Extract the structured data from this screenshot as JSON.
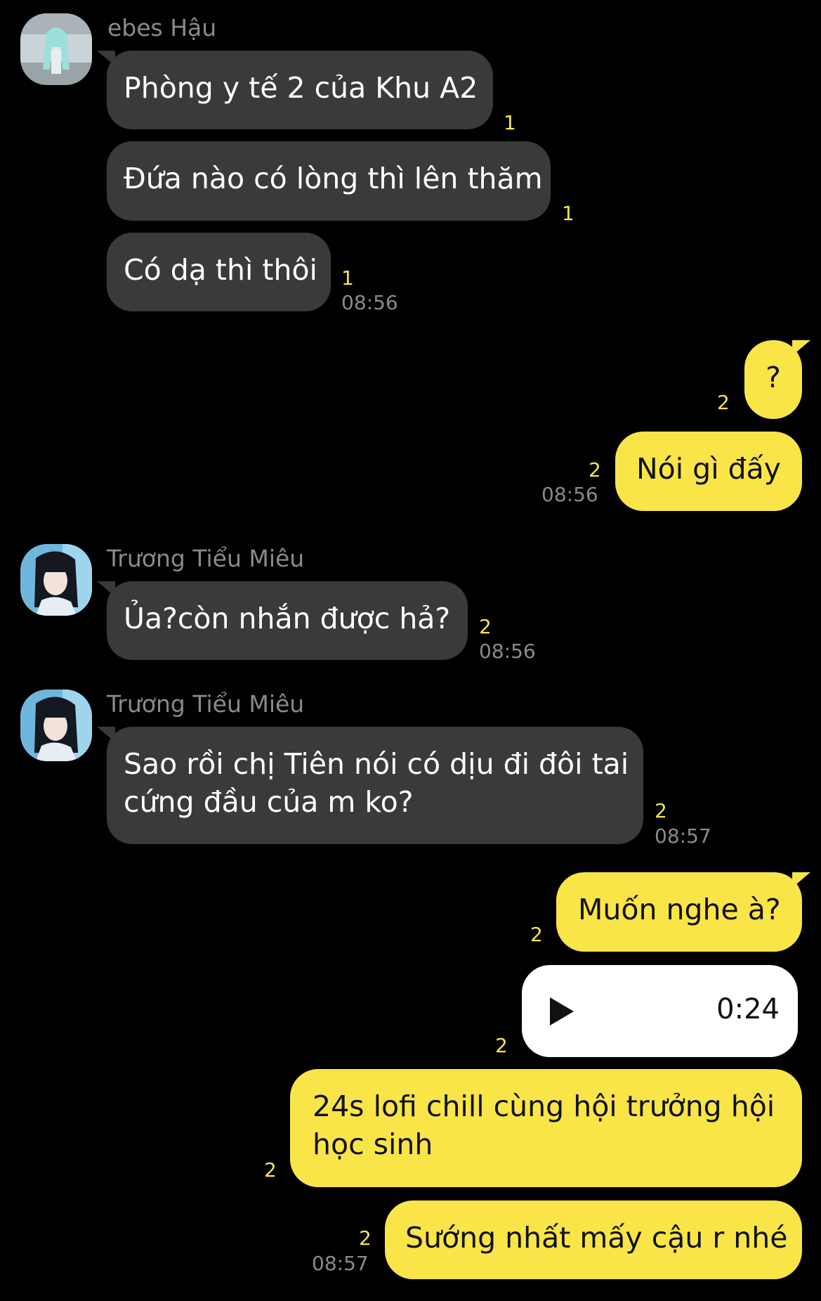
{
  "messages": [
    {
      "sender": "ebes Hậu",
      "text": "Phòng y tế 2 của Khu A2",
      "unread": "1"
    },
    {
      "text": "Đứa nào có lòng thì lên thăm",
      "unread": "1"
    },
    {
      "text": "Có dạ thì thôi",
      "unread": "1",
      "time": "08:56"
    },
    {
      "text": "?",
      "unread": "2"
    },
    {
      "text": "Nói gì đấy",
      "unread": "2",
      "time": "08:56"
    },
    {
      "sender": "Trương Tiểu Miêu",
      "text": "Ủa?còn nhắn được hả?",
      "unread": "2",
      "time": "08:56"
    },
    {
      "sender": "Trương Tiểu Miêu",
      "text": "Sao rồi chị Tiên nói có dịu đi đôi tai cứng đầu của m ko?",
      "unread": "2",
      "time": "08:57"
    },
    {
      "text": "Muốn nghe à?",
      "unread": "2"
    },
    {
      "voice_duration": "0:24",
      "unread": "2"
    },
    {
      "text": "24s lofi chill cùng hội trưởng hội học sinh",
      "unread": "2"
    },
    {
      "text": "Sướng nhất mấy cậu r nhé",
      "unread": "2",
      "time": "08:57"
    }
  ],
  "colors": {
    "background": "#000000",
    "incoming_bubble": "#3a3a3c",
    "outgoing_bubble": "#f9e547",
    "voice_bubble": "#ffffff",
    "unread_count": "#f9e547",
    "meta_text": "#8a8a8e"
  },
  "icons": {
    "play": "play-icon"
  }
}
